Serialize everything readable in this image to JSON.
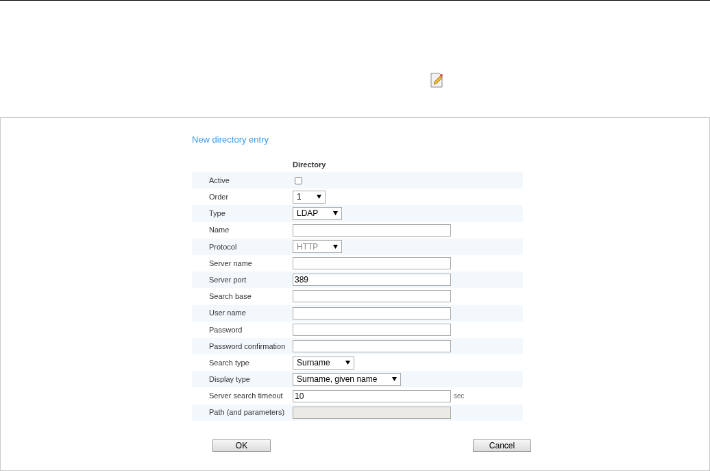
{
  "title": "New directory entry",
  "column_heading": "Directory",
  "fields": [
    {
      "kind": "checkbox",
      "label": "Active",
      "checked": false
    },
    {
      "kind": "select",
      "label": "Order",
      "value": "1",
      "disabled": false
    },
    {
      "kind": "select",
      "label": "Type",
      "value": "LDAP",
      "disabled": false
    },
    {
      "kind": "text",
      "label": "Name"
    },
    {
      "kind": "select",
      "label": "Protocol",
      "value": "HTTP",
      "disabled": true
    },
    {
      "kind": "text",
      "label": "Server name"
    },
    {
      "kind": "text",
      "label": "Server port",
      "value": "389"
    },
    {
      "kind": "text",
      "label": "Search base"
    },
    {
      "kind": "text",
      "label": "User name"
    },
    {
      "kind": "text",
      "label": "Password"
    },
    {
      "kind": "text",
      "label": "Password confirmation"
    },
    {
      "kind": "select",
      "label": "Search type",
      "value": "Surname",
      "disabled": false
    },
    {
      "kind": "select",
      "label": "Display type",
      "value": "Surname, given name",
      "disabled": false
    },
    {
      "kind": "text",
      "label": "Server search timeout",
      "value": "10",
      "unit": "sec"
    },
    {
      "kind": "readonly",
      "label": "Path (and parameters)"
    }
  ],
  "buttons": [
    "OK",
    "Cancel"
  ]
}
